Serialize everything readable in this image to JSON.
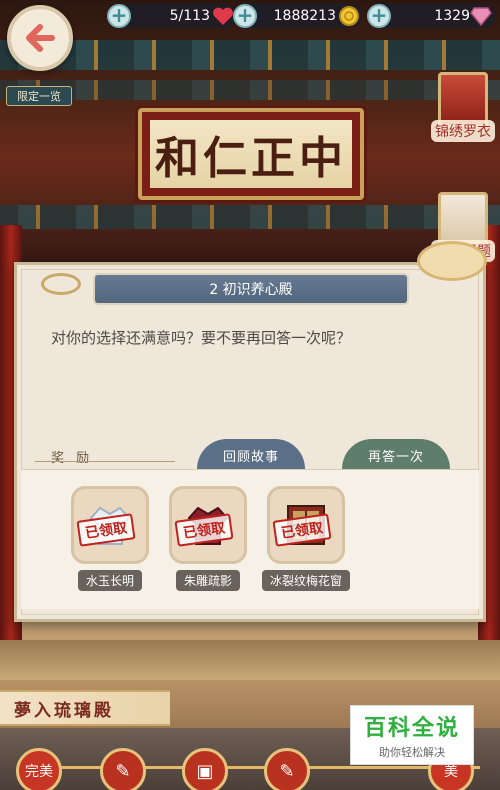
{
  "hud": {
    "stamina": "5/113",
    "coins": "1888213",
    "gems": "1329"
  },
  "scene": {
    "plaque_text": "和仁正中"
  },
  "left_tag": "限定一览",
  "side_buttons": [
    {
      "label": "锦绣罗衣"
    },
    {
      "label": "御花轻题"
    }
  ],
  "dialog": {
    "title": "2 初识养心殿",
    "question": "对你的选择还满意吗？要不要再回答一次呢？",
    "reward_label": "奖 励",
    "review_button": "回顾故事",
    "reanswer_button": "再答一次",
    "rewards": [
      {
        "name": "水玉长明",
        "stamp": "已领取",
        "icon": "garment-icon"
      },
      {
        "name": "朱雕疏影",
        "stamp": "已领取",
        "icon": "garment-icon"
      },
      {
        "name": "冰裂纹梅花窗",
        "stamp": "已领取",
        "icon": "window-icon"
      }
    ]
  },
  "bottom": {
    "banner": "夢入琉璃殿",
    "first_node": "完美",
    "last_node": "美"
  },
  "watermark": {
    "title": "百科全说",
    "subtitle": "助你轻松解决"
  },
  "colors": {
    "stamp_red": "#c0221c",
    "title_bar": "#5b6f86",
    "reanswer": "#5e7d6a"
  }
}
